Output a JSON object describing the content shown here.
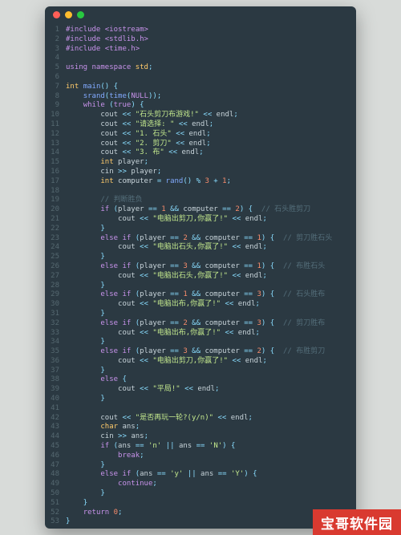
{
  "titlebar": {
    "dots": [
      "#ff5f57",
      "#febc2e",
      "#28c840"
    ]
  },
  "badge": "宝哥软件园",
  "lines": [
    {
      "n": 1,
      "tokens": [
        [
          "pp",
          "#include <iostream>"
        ]
      ]
    },
    {
      "n": 2,
      "tokens": [
        [
          "pp",
          "#include <stdlib.h>"
        ]
      ]
    },
    {
      "n": 3,
      "tokens": [
        [
          "pp",
          "#include <time.h>"
        ]
      ]
    },
    {
      "n": 4,
      "tokens": []
    },
    {
      "n": 5,
      "tokens": [
        [
          "kw",
          "using"
        ],
        [
          "id",
          " "
        ],
        [
          "kw",
          "namespace"
        ],
        [
          "id",
          " "
        ],
        [
          "type",
          "std"
        ],
        [
          "op",
          ";"
        ]
      ]
    },
    {
      "n": 6,
      "tokens": []
    },
    {
      "n": 7,
      "tokens": [
        [
          "type",
          "int"
        ],
        [
          "id",
          " "
        ],
        [
          "fn",
          "main"
        ],
        [
          "op",
          "() {"
        ]
      ]
    },
    {
      "n": 8,
      "tokens": [
        [
          "id",
          "    "
        ],
        [
          "fn",
          "srand"
        ],
        [
          "op",
          "("
        ],
        [
          "fn",
          "time"
        ],
        [
          "op",
          "("
        ],
        [
          "kw",
          "NULL"
        ],
        [
          "op",
          "));"
        ]
      ]
    },
    {
      "n": 9,
      "tokens": [
        [
          "id",
          "    "
        ],
        [
          "kw",
          "while"
        ],
        [
          "id",
          " "
        ],
        [
          "op",
          "("
        ],
        [
          "kw",
          "true"
        ],
        [
          "op",
          ") {"
        ]
      ]
    },
    {
      "n": 10,
      "tokens": [
        [
          "id",
          "        "
        ],
        [
          "id",
          "cout "
        ],
        [
          "op",
          "<< "
        ],
        [
          "str",
          "\"石头剪刀布游戏!\""
        ],
        [
          "op",
          " << "
        ],
        [
          "id",
          "endl"
        ],
        [
          "op",
          ";"
        ]
      ]
    },
    {
      "n": 11,
      "tokens": [
        [
          "id",
          "        "
        ],
        [
          "id",
          "cout "
        ],
        [
          "op",
          "<< "
        ],
        [
          "str",
          "\"请选择: \""
        ],
        [
          "op",
          " << "
        ],
        [
          "id",
          "endl"
        ],
        [
          "op",
          ";"
        ]
      ]
    },
    {
      "n": 12,
      "tokens": [
        [
          "id",
          "        "
        ],
        [
          "id",
          "cout "
        ],
        [
          "op",
          "<< "
        ],
        [
          "str",
          "\"1. 石头\""
        ],
        [
          "op",
          " << "
        ],
        [
          "id",
          "endl"
        ],
        [
          "op",
          ";"
        ]
      ]
    },
    {
      "n": 13,
      "tokens": [
        [
          "id",
          "        "
        ],
        [
          "id",
          "cout "
        ],
        [
          "op",
          "<< "
        ],
        [
          "str",
          "\"2. 剪刀\""
        ],
        [
          "op",
          " << "
        ],
        [
          "id",
          "endl"
        ],
        [
          "op",
          ";"
        ]
      ]
    },
    {
      "n": 14,
      "tokens": [
        [
          "id",
          "        "
        ],
        [
          "id",
          "cout "
        ],
        [
          "op",
          "<< "
        ],
        [
          "str",
          "\"3. 布\""
        ],
        [
          "op",
          " << "
        ],
        [
          "id",
          "endl"
        ],
        [
          "op",
          ";"
        ]
      ]
    },
    {
      "n": 15,
      "tokens": [
        [
          "id",
          "        "
        ],
        [
          "type",
          "int"
        ],
        [
          "id",
          " player"
        ],
        [
          "op",
          ";"
        ]
      ]
    },
    {
      "n": 16,
      "tokens": [
        [
          "id",
          "        "
        ],
        [
          "id",
          "cin "
        ],
        [
          "op",
          ">> "
        ],
        [
          "id",
          "player"
        ],
        [
          "op",
          ";"
        ]
      ]
    },
    {
      "n": 17,
      "tokens": [
        [
          "id",
          "        "
        ],
        [
          "type",
          "int"
        ],
        [
          "id",
          " computer "
        ],
        [
          "op",
          "= "
        ],
        [
          "fn",
          "rand"
        ],
        [
          "op",
          "() "
        ],
        [
          "op",
          "% "
        ],
        [
          "num",
          "3"
        ],
        [
          "op",
          " + "
        ],
        [
          "num",
          "1"
        ],
        [
          "op",
          ";"
        ]
      ]
    },
    {
      "n": 18,
      "tokens": []
    },
    {
      "n": 19,
      "tokens": [
        [
          "id",
          "        "
        ],
        [
          "cmt",
          "// 判断胜负"
        ]
      ]
    },
    {
      "n": 20,
      "tokens": [
        [
          "id",
          "        "
        ],
        [
          "kw",
          "if"
        ],
        [
          "id",
          " "
        ],
        [
          "op",
          "("
        ],
        [
          "id",
          "player "
        ],
        [
          "op",
          "== "
        ],
        [
          "num",
          "1"
        ],
        [
          "op",
          " && "
        ],
        [
          "id",
          "computer "
        ],
        [
          "op",
          "== "
        ],
        [
          "num",
          "2"
        ],
        [
          "op",
          ") {  "
        ],
        [
          "cmt",
          "// 石头胜剪刀"
        ]
      ]
    },
    {
      "n": 21,
      "tokens": [
        [
          "id",
          "            "
        ],
        [
          "id",
          "cout "
        ],
        [
          "op",
          "<< "
        ],
        [
          "str",
          "\"电脑出剪刀,你赢了!\""
        ],
        [
          "op",
          " << "
        ],
        [
          "id",
          "endl"
        ],
        [
          "op",
          ";"
        ]
      ]
    },
    {
      "n": 22,
      "tokens": [
        [
          "id",
          "        "
        ],
        [
          "op",
          "}"
        ]
      ]
    },
    {
      "n": 23,
      "tokens": [
        [
          "id",
          "        "
        ],
        [
          "kw",
          "else if"
        ],
        [
          "id",
          " "
        ],
        [
          "op",
          "("
        ],
        [
          "id",
          "player "
        ],
        [
          "op",
          "== "
        ],
        [
          "num",
          "2"
        ],
        [
          "op",
          " && "
        ],
        [
          "id",
          "computer "
        ],
        [
          "op",
          "== "
        ],
        [
          "num",
          "1"
        ],
        [
          "op",
          ") {  "
        ],
        [
          "cmt",
          "// 剪刀胜石头"
        ]
      ]
    },
    {
      "n": 24,
      "tokens": [
        [
          "id",
          "            "
        ],
        [
          "id",
          "cout "
        ],
        [
          "op",
          "<< "
        ],
        [
          "str",
          "\"电脑出石头,你赢了!\""
        ],
        [
          "op",
          " << "
        ],
        [
          "id",
          "endl"
        ],
        [
          "op",
          ";"
        ]
      ]
    },
    {
      "n": 25,
      "tokens": [
        [
          "id",
          "        "
        ],
        [
          "op",
          "}"
        ]
      ]
    },
    {
      "n": 26,
      "tokens": [
        [
          "id",
          "        "
        ],
        [
          "kw",
          "else if"
        ],
        [
          "id",
          " "
        ],
        [
          "op",
          "("
        ],
        [
          "id",
          "player "
        ],
        [
          "op",
          "== "
        ],
        [
          "num",
          "3"
        ],
        [
          "op",
          " && "
        ],
        [
          "id",
          "computer "
        ],
        [
          "op",
          "== "
        ],
        [
          "num",
          "1"
        ],
        [
          "op",
          ") {  "
        ],
        [
          "cmt",
          "// 布胜石头"
        ]
      ]
    },
    {
      "n": 27,
      "tokens": [
        [
          "id",
          "            "
        ],
        [
          "id",
          "cout "
        ],
        [
          "op",
          "<< "
        ],
        [
          "str",
          "\"电脑出石头,你赢了!\""
        ],
        [
          "op",
          " << "
        ],
        [
          "id",
          "endl"
        ],
        [
          "op",
          ";"
        ]
      ]
    },
    {
      "n": 28,
      "tokens": [
        [
          "id",
          "        "
        ],
        [
          "op",
          "}"
        ]
      ]
    },
    {
      "n": 29,
      "tokens": [
        [
          "id",
          "        "
        ],
        [
          "kw",
          "else if"
        ],
        [
          "id",
          " "
        ],
        [
          "op",
          "("
        ],
        [
          "id",
          "player "
        ],
        [
          "op",
          "== "
        ],
        [
          "num",
          "1"
        ],
        [
          "op",
          " && "
        ],
        [
          "id",
          "computer "
        ],
        [
          "op",
          "== "
        ],
        [
          "num",
          "3"
        ],
        [
          "op",
          ") {  "
        ],
        [
          "cmt",
          "// 石头胜布"
        ]
      ]
    },
    {
      "n": 30,
      "tokens": [
        [
          "id",
          "            "
        ],
        [
          "id",
          "cout "
        ],
        [
          "op",
          "<< "
        ],
        [
          "str",
          "\"电脑出布,你赢了!\""
        ],
        [
          "op",
          " << "
        ],
        [
          "id",
          "endl"
        ],
        [
          "op",
          ";"
        ]
      ]
    },
    {
      "n": 31,
      "tokens": [
        [
          "id",
          "        "
        ],
        [
          "op",
          "}"
        ]
      ]
    },
    {
      "n": 32,
      "tokens": [
        [
          "id",
          "        "
        ],
        [
          "kw",
          "else if"
        ],
        [
          "id",
          " "
        ],
        [
          "op",
          "("
        ],
        [
          "id",
          "player "
        ],
        [
          "op",
          "== "
        ],
        [
          "num",
          "2"
        ],
        [
          "op",
          " && "
        ],
        [
          "id",
          "computer "
        ],
        [
          "op",
          "== "
        ],
        [
          "num",
          "3"
        ],
        [
          "op",
          ") {  "
        ],
        [
          "cmt",
          "// 剪刀胜布"
        ]
      ]
    },
    {
      "n": 33,
      "tokens": [
        [
          "id",
          "            "
        ],
        [
          "id",
          "cout "
        ],
        [
          "op",
          "<< "
        ],
        [
          "str",
          "\"电脑出布,你赢了!\""
        ],
        [
          "op",
          " << "
        ],
        [
          "id",
          "endl"
        ],
        [
          "op",
          ";"
        ]
      ]
    },
    {
      "n": 34,
      "tokens": [
        [
          "id",
          "        "
        ],
        [
          "op",
          "}"
        ]
      ]
    },
    {
      "n": 35,
      "tokens": [
        [
          "id",
          "        "
        ],
        [
          "kw",
          "else if"
        ],
        [
          "id",
          " "
        ],
        [
          "op",
          "("
        ],
        [
          "id",
          "player "
        ],
        [
          "op",
          "== "
        ],
        [
          "num",
          "3"
        ],
        [
          "op",
          " && "
        ],
        [
          "id",
          "computer "
        ],
        [
          "op",
          "== "
        ],
        [
          "num",
          "2"
        ],
        [
          "op",
          ") {  "
        ],
        [
          "cmt",
          "// 布胜剪刀"
        ]
      ]
    },
    {
      "n": 36,
      "tokens": [
        [
          "id",
          "            "
        ],
        [
          "id",
          "cout "
        ],
        [
          "op",
          "<< "
        ],
        [
          "str",
          "\"电脑出剪刀,你赢了!\""
        ],
        [
          "op",
          " << "
        ],
        [
          "id",
          "endl"
        ],
        [
          "op",
          ";"
        ]
      ]
    },
    {
      "n": 37,
      "tokens": [
        [
          "id",
          "        "
        ],
        [
          "op",
          "}"
        ]
      ]
    },
    {
      "n": 38,
      "tokens": [
        [
          "id",
          "        "
        ],
        [
          "kw",
          "else"
        ],
        [
          "id",
          " "
        ],
        [
          "op",
          "{"
        ]
      ]
    },
    {
      "n": 39,
      "tokens": [
        [
          "id",
          "            "
        ],
        [
          "id",
          "cout "
        ],
        [
          "op",
          "<< "
        ],
        [
          "str",
          "\"平局!\""
        ],
        [
          "op",
          " << "
        ],
        [
          "id",
          "endl"
        ],
        [
          "op",
          ";"
        ]
      ]
    },
    {
      "n": 40,
      "tokens": [
        [
          "id",
          "        "
        ],
        [
          "op",
          "}"
        ]
      ]
    },
    {
      "n": 41,
      "tokens": []
    },
    {
      "n": 42,
      "tokens": [
        [
          "id",
          "        "
        ],
        [
          "id",
          "cout "
        ],
        [
          "op",
          "<< "
        ],
        [
          "str",
          "\"是否再玩一轮?(y/n)\""
        ],
        [
          "op",
          " << "
        ],
        [
          "id",
          "endl"
        ],
        [
          "op",
          ";"
        ]
      ]
    },
    {
      "n": 43,
      "tokens": [
        [
          "id",
          "        "
        ],
        [
          "type",
          "char"
        ],
        [
          "id",
          " ans"
        ],
        [
          "op",
          ";"
        ]
      ]
    },
    {
      "n": 44,
      "tokens": [
        [
          "id",
          "        "
        ],
        [
          "id",
          "cin "
        ],
        [
          "op",
          ">> "
        ],
        [
          "id",
          "ans"
        ],
        [
          "op",
          ";"
        ]
      ]
    },
    {
      "n": 45,
      "tokens": [
        [
          "id",
          "        "
        ],
        [
          "kw",
          "if"
        ],
        [
          "id",
          " "
        ],
        [
          "op",
          "("
        ],
        [
          "id",
          "ans "
        ],
        [
          "op",
          "== "
        ],
        [
          "str",
          "'n'"
        ],
        [
          "op",
          " || "
        ],
        [
          "id",
          "ans "
        ],
        [
          "op",
          "== "
        ],
        [
          "str",
          "'N'"
        ],
        [
          "op",
          ") {"
        ]
      ]
    },
    {
      "n": 46,
      "tokens": [
        [
          "id",
          "            "
        ],
        [
          "kw",
          "break"
        ],
        [
          "op",
          ";"
        ]
      ]
    },
    {
      "n": 47,
      "tokens": [
        [
          "id",
          "        "
        ],
        [
          "op",
          "}"
        ]
      ]
    },
    {
      "n": 48,
      "tokens": [
        [
          "id",
          "        "
        ],
        [
          "kw",
          "else if"
        ],
        [
          "id",
          " "
        ],
        [
          "op",
          "("
        ],
        [
          "id",
          "ans "
        ],
        [
          "op",
          "== "
        ],
        [
          "str",
          "'y'"
        ],
        [
          "op",
          " || "
        ],
        [
          "id",
          "ans "
        ],
        [
          "op",
          "== "
        ],
        [
          "str",
          "'Y'"
        ],
        [
          "op",
          ") {"
        ]
      ]
    },
    {
      "n": 49,
      "tokens": [
        [
          "id",
          "            "
        ],
        [
          "kw",
          "continue"
        ],
        [
          "op",
          ";"
        ]
      ]
    },
    {
      "n": 50,
      "tokens": [
        [
          "id",
          "        "
        ],
        [
          "op",
          "}"
        ]
      ]
    },
    {
      "n": 51,
      "tokens": [
        [
          "id",
          "    "
        ],
        [
          "op",
          "}"
        ]
      ]
    },
    {
      "n": 52,
      "tokens": [
        [
          "id",
          "    "
        ],
        [
          "kw",
          "return"
        ],
        [
          "id",
          " "
        ],
        [
          "num",
          "0"
        ],
        [
          "op",
          ";"
        ]
      ]
    },
    {
      "n": 53,
      "tokens": [
        [
          "op",
          "}"
        ]
      ]
    }
  ]
}
